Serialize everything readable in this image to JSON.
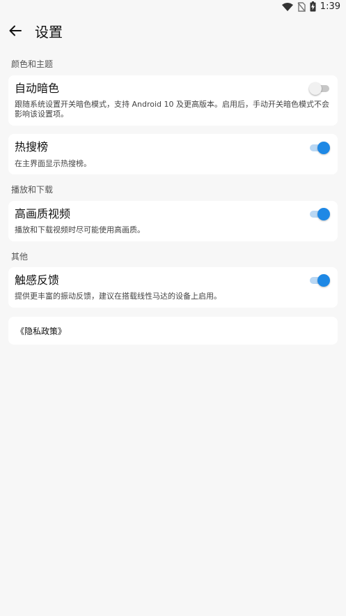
{
  "status_bar": {
    "time": "1:39",
    "icons": [
      "wifi-icon",
      "no-sim-icon",
      "battery-charging-icon"
    ]
  },
  "header": {
    "back_icon": "arrow-left-icon",
    "title": "设置"
  },
  "sections": [
    {
      "header": "颜色和主题",
      "items": [
        {
          "title": "自动暗色",
          "description": "跟随系统设置开关暗色模式，支持 Android 10 及更高版本。启用后，手动开关暗色模式不会影响该设置项。",
          "enabled": false
        }
      ]
    },
    {
      "header": "",
      "items": [
        {
          "title": "热搜榜",
          "description": "在主界面显示热搜榜。",
          "enabled": true
        }
      ]
    },
    {
      "header": "播放和下载",
      "items": [
        {
          "title": "高画质视频",
          "description": "播放和下载视频时尽可能使用高画质。",
          "enabled": true
        }
      ]
    },
    {
      "header": "其他",
      "items": [
        {
          "title": "触感反馈",
          "description": "提供更丰富的振动反馈，建议在搭载线性马达的设备上启用。",
          "enabled": true
        }
      ]
    }
  ],
  "privacy_policy": {
    "label": "《隐私政策》"
  },
  "colors": {
    "background": "#f7f7f7",
    "card": "#ffffff",
    "accent": "#1e88e5",
    "accent_track": "#b9d7f3",
    "off_track": "#c7c7c7"
  }
}
